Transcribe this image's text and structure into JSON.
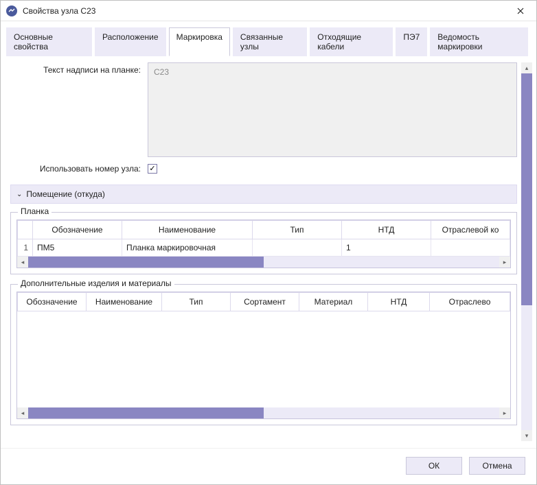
{
  "window": {
    "title": "Свойства узла C23"
  },
  "tabs": [
    {
      "label": "Основные свойства",
      "active": false
    },
    {
      "label": "Расположение",
      "active": false
    },
    {
      "label": "Маркировка",
      "active": true
    },
    {
      "label": "Связанные узлы",
      "active": false
    },
    {
      "label": "Отходящие кабели",
      "active": false
    },
    {
      "label": "ПЭ7",
      "active": false
    },
    {
      "label": "Ведомость маркировки",
      "active": false
    }
  ],
  "form": {
    "label_text": "Текст надписи на планке:",
    "label_value": "C23",
    "use_node_number_label": "Использовать номер узла:",
    "use_node_number_checked": true
  },
  "group1": {
    "title": "Помещение (откуда)"
  },
  "grid1": {
    "legend": "Планка",
    "headers": [
      "Обозначение",
      "Наименование",
      "Тип",
      "НТД",
      "Отраслевой ко"
    ],
    "rows": [
      {
        "n": "1",
        "cells": [
          "ПМ5",
          "Планка маркировочная",
          "",
          "1",
          ""
        ]
      }
    ]
  },
  "grid2": {
    "legend": "Дополнительные изделия и материалы",
    "headers": [
      "Обозначение",
      "Наименование",
      "Тип",
      "Сортамент",
      "Материал",
      "НТД",
      "Отраслево"
    ],
    "rows": []
  },
  "buttons": {
    "ok": "ОК",
    "cancel": "Отмена"
  }
}
